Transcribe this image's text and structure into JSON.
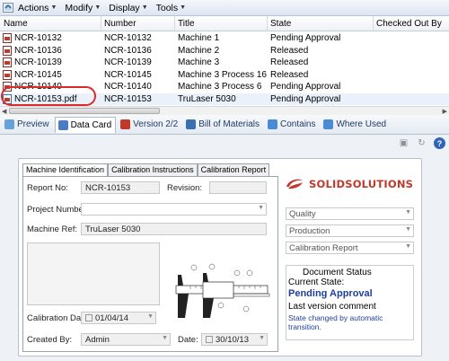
{
  "toolbar": {
    "menus": [
      {
        "label": "Actions"
      },
      {
        "label": "Modify"
      },
      {
        "label": "Display"
      },
      {
        "label": "Tools"
      }
    ]
  },
  "grid": {
    "columns": [
      "Name",
      "Number",
      "Title",
      "State",
      "Checked Out By"
    ],
    "rows": [
      {
        "name": "NCR-10132",
        "number": "NCR-10132",
        "title": "Machine 1",
        "state": "Pending Approval"
      },
      {
        "name": "NCR-10136",
        "number": "NCR-10136",
        "title": "Machine 2",
        "state": "Released"
      },
      {
        "name": "NCR-10139",
        "number": "NCR-10139",
        "title": "Machine 3",
        "state": "Released"
      },
      {
        "name": "NCR-10145",
        "number": "NCR-10145",
        "title": "Machine 3 Process 16",
        "state": "Released"
      },
      {
        "name": "NCR-10140",
        "number": "NCR-10140",
        "title": "Machine 3 Process 6",
        "state": "Pending Approval"
      },
      {
        "name": "NCR-10153.pdf",
        "number": "NCR-10153",
        "title": "TruLaser 5030",
        "state": "Pending Approval",
        "selected": true
      }
    ]
  },
  "tabs": [
    {
      "label": "Preview",
      "icon": "preview-icon",
      "color": "#6aa0d8"
    },
    {
      "label": "Data Card",
      "icon": "data-card-icon",
      "color": "#4a7cc4",
      "active": true
    },
    {
      "label": "Version 2/2",
      "icon": "version-icon",
      "color": "#c0392b"
    },
    {
      "label": "Bill of Materials",
      "icon": "bom-icon",
      "color": "#3b6fb0"
    },
    {
      "label": "Contains",
      "icon": "contains-icon",
      "color": "#4b8bd6"
    },
    {
      "label": "Where Used",
      "icon": "where-used-icon",
      "color": "#4b8bd6"
    }
  ],
  "card": {
    "tabs": [
      "Machine Identification",
      "Calibration Instructions",
      "Calibration Report"
    ],
    "report_no_label": "Report No:",
    "report_no": "NCR-10153",
    "revision_label": "Revision:",
    "revision": "",
    "project_label": "Project Number:",
    "project": "",
    "machine_label": "Machine Ref:",
    "machine": "TruLaser 5030",
    "calibration_date_label": "Calibration Date:",
    "calibration_date": "01/04/14",
    "created_by_label": "Created By:",
    "created_by": "Admin",
    "date_label": "Date:",
    "date": "30/10/13",
    "brand": "SOLIDSOLUTIONS",
    "quality": "Quality",
    "production": "Production",
    "calibration_report": "Calibration Report",
    "status": {
      "title": "Document Status",
      "current_label": "Current State:",
      "current": "Pending Approval",
      "comment_label": "Last version comment",
      "comment": "State changed by automatic transition."
    }
  },
  "colors": {
    "accent": "#1f3f9a",
    "selection_outline": "#d92b2b",
    "brand": "#c0392b"
  }
}
